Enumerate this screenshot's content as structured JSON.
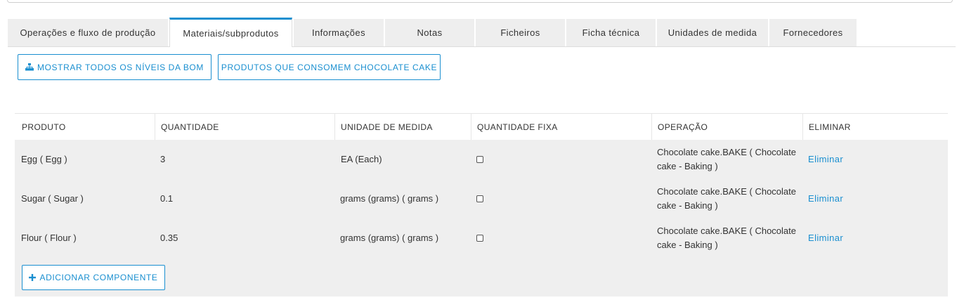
{
  "tabs": [
    {
      "label": "Operações e fluxo de produção",
      "active": false
    },
    {
      "label": "Materiais/subprodutos",
      "active": true
    },
    {
      "label": "Informações",
      "active": false
    },
    {
      "label": "Notas",
      "active": false
    },
    {
      "label": "Ficheiros",
      "active": false
    },
    {
      "label": "Ficha técnica",
      "active": false
    },
    {
      "label": "Unidades de medida",
      "active": false
    },
    {
      "label": "Fornecedores",
      "active": false
    }
  ],
  "actions": {
    "show_bom_label": "MOSTRAR TODOS OS NÍVEIS DA BOM",
    "consumers_label": "PRODUTOS QUE CONSOMEM CHOCOLATE CAKE",
    "add_component_label": "ADICIONAR COMPONENTE"
  },
  "table": {
    "columns": [
      "PRODUTO",
      "QUANTIDADE",
      "UNIDADE DE MEDIDA",
      "QUANTIDADE FIXA",
      "OPERAÇÃO",
      "ELIMINAR"
    ],
    "rows": [
      {
        "product": "Egg ( Egg )",
        "quantity": "3",
        "uom": "EA (Each)",
        "fixed": false,
        "operation": "Chocolate cake.BAKE ( Chocolate cake - Baking )",
        "delete": "Eliminar"
      },
      {
        "product": "Sugar ( Sugar )",
        "quantity": "0.1",
        "uom": "grams (grams) ( grams )",
        "fixed": false,
        "operation": "Chocolate cake.BAKE ( Chocolate cake - Baking )",
        "delete": "Eliminar"
      },
      {
        "product": "Flour ( Flour )",
        "quantity": "0.35",
        "uom": "grams (grams) ( grams )",
        "fixed": false,
        "operation": "Chocolate cake.BAKE ( Chocolate cake - Baking )",
        "delete": "Eliminar"
      }
    ]
  },
  "colors": {
    "accent": "#1a8fd0",
    "tab_bg": "#eeeeee",
    "row_bg": "#efefef"
  },
  "icons": {
    "bom": "sitemap-icon",
    "add": "plus-icon"
  }
}
